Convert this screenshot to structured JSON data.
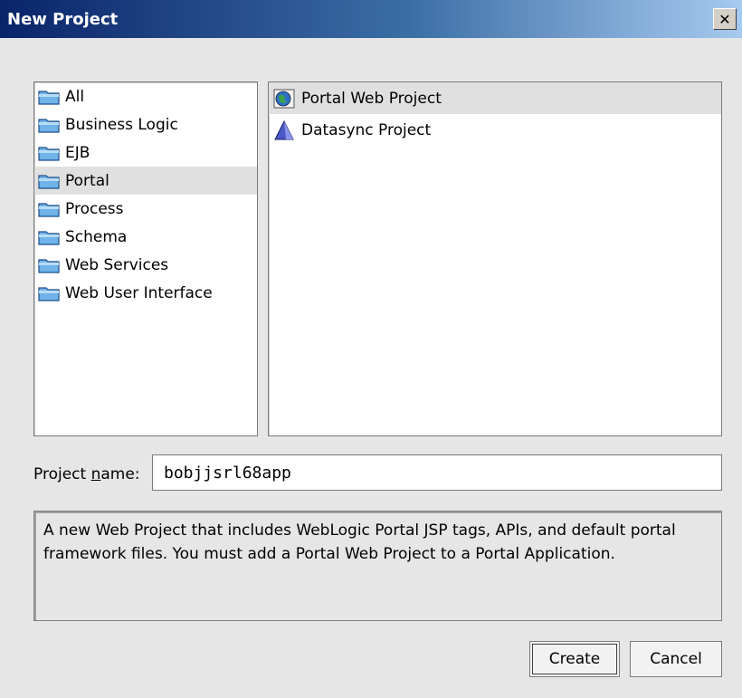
{
  "window": {
    "title": "New Project",
    "close_glyph": "✕"
  },
  "categories": [
    {
      "label": "All",
      "icon": "folder-icon",
      "selected": false
    },
    {
      "label": "Business Logic",
      "icon": "folder-icon",
      "selected": false
    },
    {
      "label": "EJB",
      "icon": "folder-icon",
      "selected": false
    },
    {
      "label": "Portal",
      "icon": "folder-icon",
      "selected": true
    },
    {
      "label": "Process",
      "icon": "folder-icon",
      "selected": false
    },
    {
      "label": "Schema",
      "icon": "folder-icon",
      "selected": false
    },
    {
      "label": "Web Services",
      "icon": "folder-icon",
      "selected": false
    },
    {
      "label": "Web User Interface",
      "icon": "folder-icon",
      "selected": false
    }
  ],
  "project_types": [
    {
      "label": "Portal Web Project",
      "icon": "globe-icon",
      "selected": true
    },
    {
      "label": "Datasync Project",
      "icon": "pyramid-icon",
      "selected": false
    }
  ],
  "project_name": {
    "label_prefix": "Project ",
    "label_mnemonic": "n",
    "label_suffix": "ame:",
    "value": "bobjjsrl68app"
  },
  "description": "A new Web Project that includes WebLogic Portal JSP tags, APIs, and default portal framework files. You must add a Portal Web Project to a Portal Application.",
  "buttons": {
    "create": "Create",
    "cancel": "Cancel"
  },
  "colors": {
    "title_start": "#0a246a",
    "title_end": "#a6caf0",
    "folder": "#6fb3e8",
    "selection": "#e0e0e0"
  }
}
